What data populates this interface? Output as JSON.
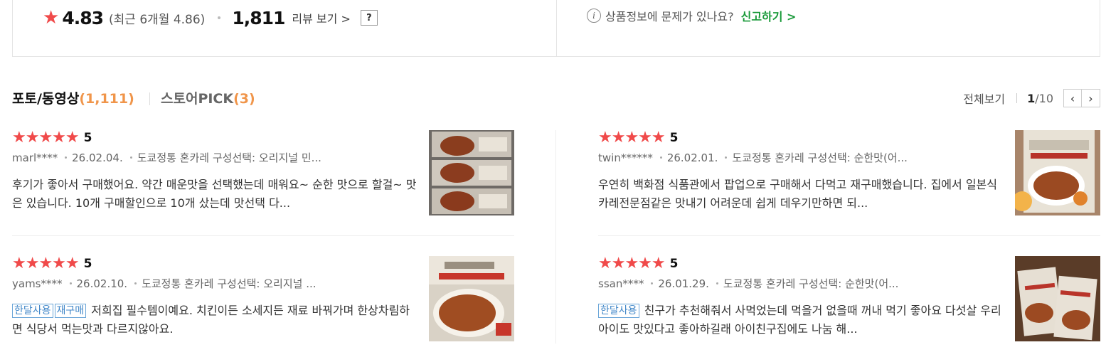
{
  "summary": {
    "star": "★",
    "rating": "4.83",
    "recent": "(최근 6개월 4.86)",
    "review_count": "1,811",
    "review_link": "리뷰 보기 >",
    "help": "?",
    "info_glyph": "i",
    "report_question": "상품정보에 문제가 있나요?",
    "report_link": "신고하기 >"
  },
  "section": {
    "tab_photo_label": "포토/동영상",
    "tab_photo_count": "(1,111)",
    "tab_store_label": "스토어PICK",
    "tab_store_count": "(3)",
    "view_all": "전체보기",
    "page_current": "1",
    "page_total": "/10",
    "prev": "‹",
    "next": "›"
  },
  "reviews": [
    {
      "stars": "★★★★★",
      "score": "5",
      "user": "marl****",
      "date": "26.02.04.",
      "option": "도쿄정통 혼카레 구성선택: 오리지널 민...",
      "tags": [],
      "text": "후기가 좋아서 구매했어요. 약간 매운맛을 선택했는데 매워요~ 순한 맛으로 할걸~ 맛은 있습니다. 10개 구매할인으로 10개 샀는데 맛선택 다..."
    },
    {
      "stars": "★★★★★",
      "score": "5",
      "user": "twin******",
      "date": "26.02.01.",
      "option": "도쿄정통 혼카레 구성선택: 순한맛(어...",
      "tags": [],
      "text": "우연히 백화점 식품관에서 팝업으로 구매해서 다먹고 재구매했습니다. 집에서 일본식카레전문점같은 맛내기 어려운데 쉽게 데우기만하면 되..."
    },
    {
      "stars": "★★★★★",
      "score": "5",
      "user": "yams****",
      "date": "26.02.10.",
      "option": "도쿄정통 혼카레 구성선택: 오리지널 ...",
      "tags": [
        "한달사용",
        "재구매"
      ],
      "text": "저희집 필수템이예요. 치킨이든 소세지든 재료 바꿔가며 한상차림하면 식당서 먹는맛과 다르지않아요."
    },
    {
      "stars": "★★★★★",
      "score": "5",
      "user": "ssan****",
      "date": "26.01.29.",
      "option": "도쿄정통 혼카레 구성선택: 순한맛(어...",
      "tags": [
        "한달사용"
      ],
      "text": "친구가 추천해줘서 사먹었는데 먹을거 없을때 꺼내 먹기 좋아요 다섯살 우리 아이도 맛있다고 좋아하길래 아이친구집에도 나눔 해..."
    }
  ],
  "colors": {
    "star": "#f04a4a",
    "count_orange": "#f0954a",
    "report_green": "#1a9a3a",
    "tag_blue": "#3f86c8"
  }
}
